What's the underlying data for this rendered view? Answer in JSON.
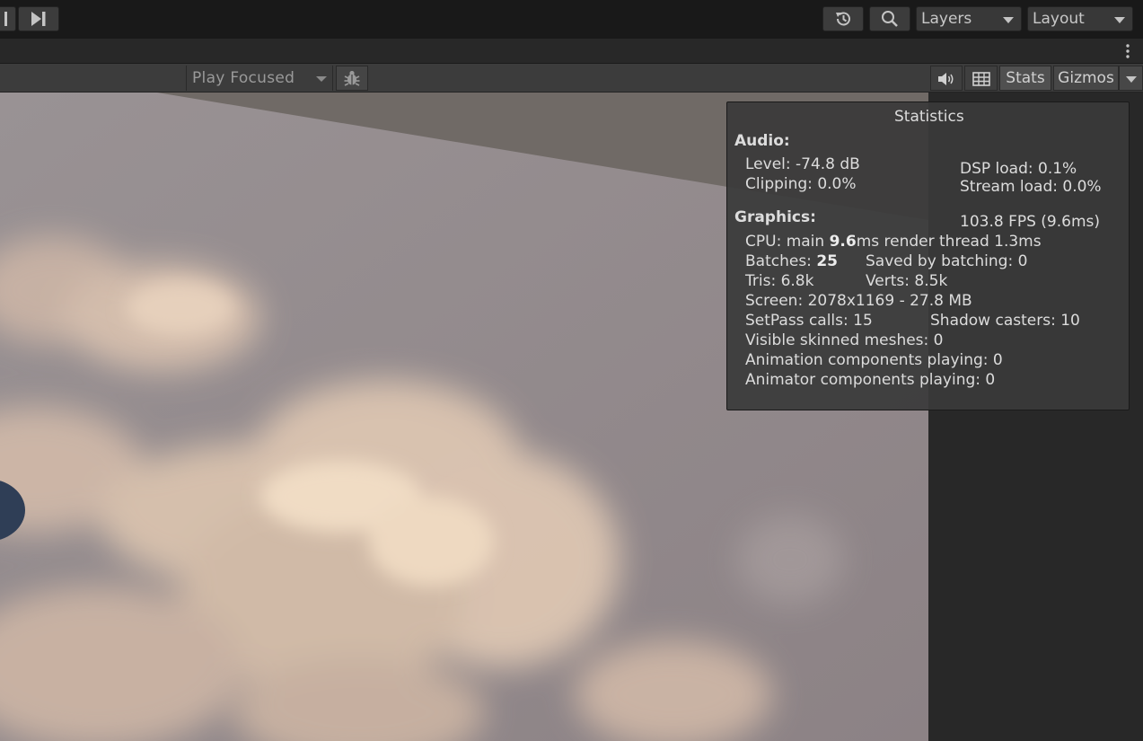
{
  "toolbar": {
    "layers_label": "Layers",
    "layout_label": "Layout"
  },
  "game_toolbar": {
    "play_mode_label": "Play Focused",
    "stats_label": "Stats",
    "gizmos_label": "Gizmos"
  },
  "statistics": {
    "title": "Statistics",
    "audio_header": "Audio:",
    "level": "Level: -74.8 dB",
    "clipping": "Clipping: 0.0%",
    "dsp_load": "DSP load: 0.1%",
    "stream_load": "Stream load: 0.0%",
    "graphics_header": "Graphics:",
    "fps": "103.8 FPS (9.6ms)",
    "cpu_prefix": "CPU: main ",
    "cpu_main": "9.6",
    "cpu_suffix": "ms  render thread 1.3ms",
    "batches_prefix": "Batches: ",
    "batches_value": "25",
    "saved_by_batching": "Saved by batching: 0",
    "tris": "Tris: 6.8k",
    "verts": "Verts: 8.5k",
    "screen": "Screen: 2078x1169 - 27.8 MB",
    "setpass_calls": "SetPass calls: 15",
    "shadow_casters": "Shadow casters: 10",
    "visible_skinned_meshes": "Visible skinned meshes: 0",
    "animation_components": "Animation components playing: 0",
    "animator_components": "Animator components playing: 0"
  },
  "icons": [
    "step-icon",
    "history-icon",
    "search-icon",
    "kebab-menu-icon",
    "bug-icon",
    "audio-icon",
    "grid-icon"
  ],
  "colors": {
    "background": "#191919",
    "toolbar": "#3c3c3c",
    "stats_panel": "#3a3a3a",
    "sky": "#8c8487"
  }
}
